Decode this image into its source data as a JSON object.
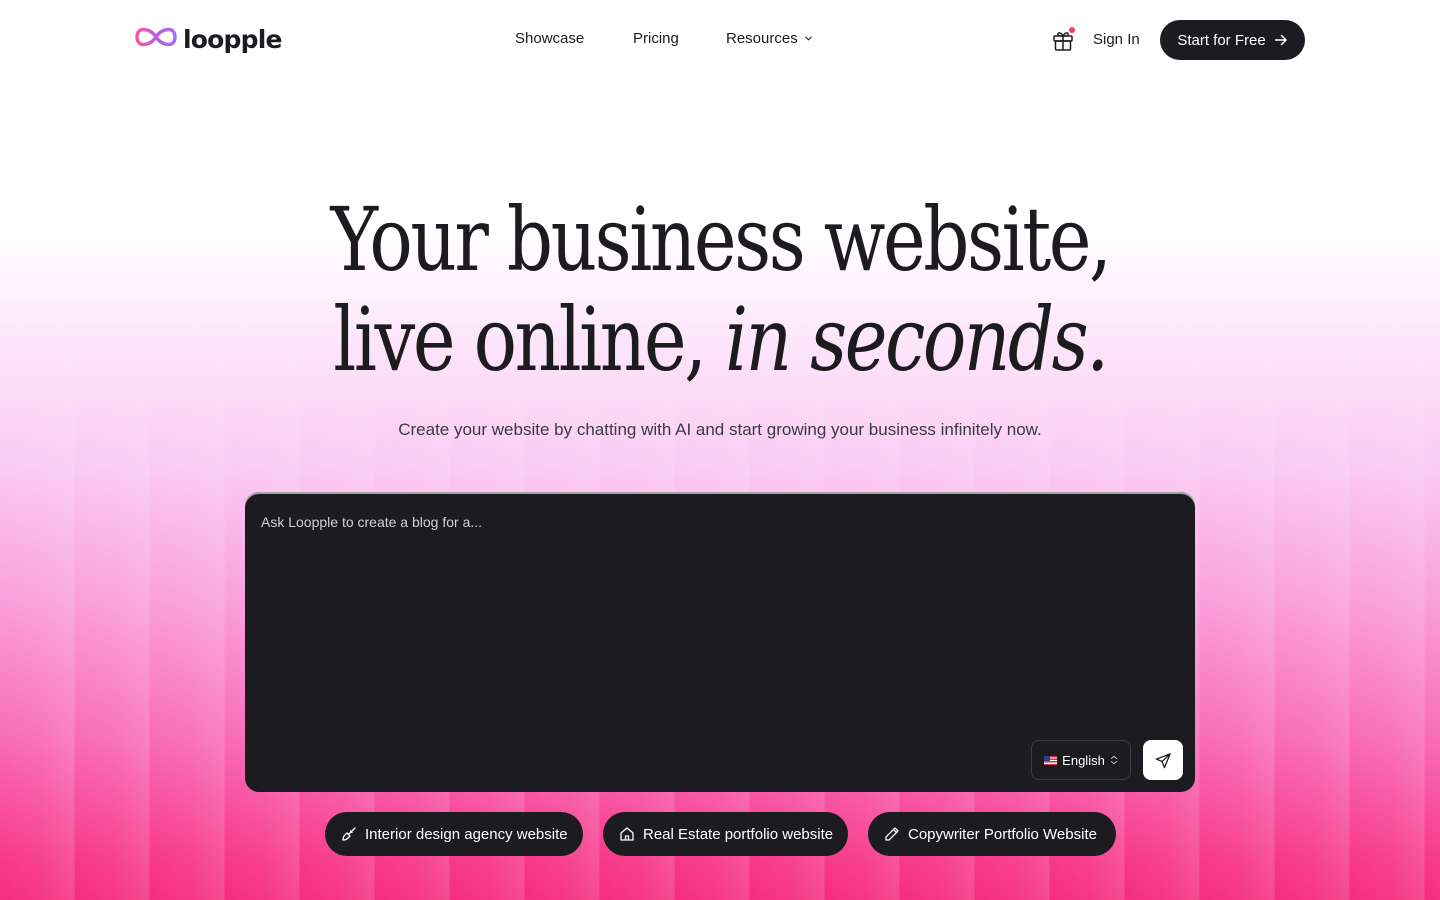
{
  "brand": {
    "name": "loopple",
    "logo_icon": "infinity-logo-icon",
    "gradient_colors": [
      "#f45b9c",
      "#a46bf5"
    ]
  },
  "nav": {
    "items": [
      {
        "label": "Showcase"
      },
      {
        "label": "Pricing"
      },
      {
        "label": "Resources",
        "icon": "chevron-down-icon"
      }
    ],
    "gift_icon": "gift-icon",
    "sign_in": "Sign In",
    "cta": {
      "label": "Start for Free",
      "icon": "arrow-right-icon"
    }
  },
  "hero": {
    "title_line1": "Your business website,",
    "title_line2_prefix": "live online, ",
    "title_line2_italic": "in seconds.",
    "subtitle": "Create your website by chatting with AI and start growing your business infinitely now."
  },
  "prompt": {
    "placeholder": "Ask Loopple to create a blog for a...",
    "value": "",
    "language": {
      "selected": "English",
      "flag": "us-flag-icon"
    },
    "send_icon": "send-icon"
  },
  "suggestions": [
    {
      "label": "Interior design agency website",
      "icon": "paintbrush-icon"
    },
    {
      "label": "Real Estate portfolio website",
      "icon": "home-icon"
    },
    {
      "label": "Copywriter Portfolio Website",
      "icon": "pencil-icon"
    }
  ],
  "colors": {
    "dark": "#1c1b1f",
    "accent_pink": "#f52d7e",
    "notification_dot": "#ef3f5a"
  }
}
